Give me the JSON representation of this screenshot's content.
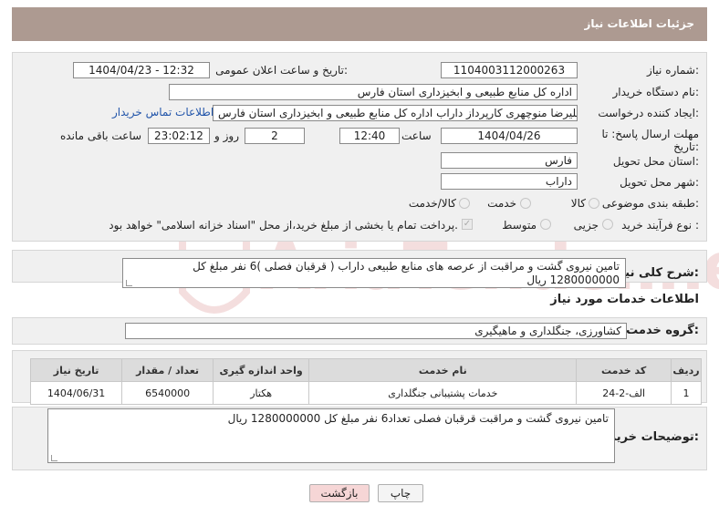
{
  "header": {
    "title": "جزئیات اطلاعات نیاز"
  },
  "need_number": {
    "label": "شماره نیاز:",
    "value": "1104003112000263"
  },
  "announce_datetime": {
    "label": "تاریخ و ساعت اعلان عمومی:",
    "value": "1404/04/23 - 12:32"
  },
  "buyer_org": {
    "label": "نام دستگاه خریدار:",
    "value": "اداره کل منابع طبیعی و ابخیزداری استان فارس"
  },
  "requester": {
    "label": "ایجاد کننده درخواست:",
    "value": "علیرضا منوچهری کارپرداز داراب اداره کل منابع طبیعی و ابخیزداری استان فارس",
    "contact_link": "اطلاعات تماس خریدار"
  },
  "deadline": {
    "label_line1": "مهلت ارسال پاسخ: تا",
    "label_line2": "تاریخ:",
    "date": "1404/04/26",
    "time_label": "ساعت",
    "time": "12:40",
    "days": "2",
    "days_label": "روز و",
    "remaining": "23:02:12",
    "remaining_label": "ساعت باقی مانده"
  },
  "delivery_province": {
    "label": "استان محل تحویل:",
    "value": "فارس"
  },
  "delivery_city": {
    "label": "شهر محل تحویل:",
    "value": "داراب"
  },
  "category": {
    "label": "طبقه بندی موضوعی:",
    "options": [
      "کالا",
      "خدمت",
      "کالا/خدمت"
    ]
  },
  "purchase_type": {
    "label": "نوع فرآیند خرید :",
    "options": [
      "جزیی",
      "متوسط"
    ],
    "note": "پرداخت تمام یا بخشی از مبلغ خرید،از محل \"اسناد خزانه اسلامی\" خواهد بود."
  },
  "summary": {
    "label": "شرح کلی نیاز:",
    "value": "تامین نیروی گشت و مراقبت از عرصه های منابع طبیعی داراب ( قرقبان فصلی )6 نفر مبلغ کل 1280000000 ریال"
  },
  "services_section": {
    "title": "اطلاعات خدمات مورد نیاز"
  },
  "service_group": {
    "label": "گروه خدمت:",
    "value": "کشاورزی، جنگلداری و ماهیگیری"
  },
  "table": {
    "headers": [
      "ردیف",
      "کد خدمت",
      "نام خدمت",
      "واحد اندازه گیری",
      "تعداد / مقدار",
      "تاریخ نیاز"
    ],
    "rows": [
      [
        "1",
        "الف-2-24",
        "خدمات پشتیبانی جنگلداری",
        "هکتار",
        "6540000",
        "1404/06/31"
      ]
    ]
  },
  "buyer_notes": {
    "label": "توضیحات خریدار:",
    "value": "تامین نیروی گشت و مراقبت قرقبان فصلی تعداد6 نفر مبلغ کل 1280000000 ریال"
  },
  "buttons": {
    "print": "چاپ",
    "back": "بازگشت"
  },
  "watermark": {
    "text": "AriaTender.neT"
  },
  "colors": {
    "header_bg": "#ad9a91",
    "link": "#2255aa",
    "back_bg": "#f6d6d6",
    "watermark": "#e8b6b6"
  }
}
